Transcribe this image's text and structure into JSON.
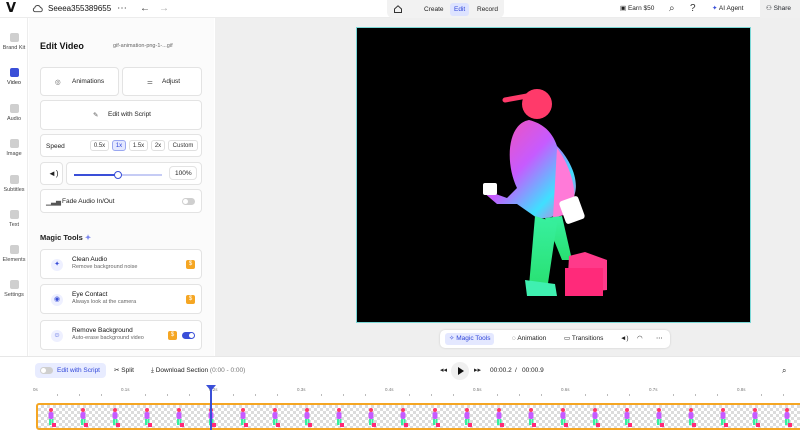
{
  "app": {
    "logo": "V",
    "project_name": "Seeea355389655"
  },
  "header": {
    "more_icon": "ellipsis-icon",
    "modes": [
      "Create",
      "Edit",
      "Record"
    ],
    "active_mode": "Edit",
    "earn": "Earn $50",
    "ai_agent": "AI Agent",
    "share": "Share"
  },
  "nav": [
    {
      "label": "Brand Kit",
      "icon": "brand-kit-icon"
    },
    {
      "label": "Video",
      "icon": "video-icon",
      "active": true
    },
    {
      "label": "Audio",
      "icon": "audio-icon"
    },
    {
      "label": "Image",
      "icon": "image-icon"
    },
    {
      "label": "Subtitles",
      "icon": "subtitles-icon"
    },
    {
      "label": "Text",
      "icon": "text-icon"
    },
    {
      "label": "Elements",
      "icon": "elements-icon"
    },
    {
      "label": "Settings",
      "icon": "settings-icon"
    }
  ],
  "panel": {
    "title": "Edit Video",
    "file": "gif-animation-png-1-...gif",
    "animations": "Animations",
    "adjust": "Adjust",
    "edit_with_script": "Edit with Script",
    "speed_label": "Speed",
    "speeds": [
      "0.5x",
      "1x",
      "1.5x",
      "2x",
      "Custom"
    ],
    "active_speed": "1x",
    "volume_value": "100%",
    "volume_level": 0.5,
    "fade_audio": "Fade Audio In/Out",
    "fade_on": false,
    "magic_tools_title": "Magic Tools",
    "tools": [
      {
        "title": "Clean Audio",
        "subtitle": "Remove background noise",
        "badge": "$"
      },
      {
        "title": "Eye Contact",
        "subtitle": "Always look at the camera",
        "badge": "$"
      },
      {
        "title": "Remove Background",
        "subtitle": "Auto-erase background video",
        "badge": "$",
        "toggle_on": true
      }
    ]
  },
  "canvas_tools": {
    "magic_tools": "Magic Tools",
    "animation": "Animation",
    "transitions": "Transitions"
  },
  "timeline": {
    "edit_with_script": "Edit with Script",
    "split": "Split",
    "download_section": "Download Section",
    "download_range": "(0:00 - 0:00)",
    "current_time": "00:00.2",
    "total_time": "00:00.9",
    "ruler": [
      "0s",
      "0.1s",
      "0.2s",
      "0.3s",
      "0.4s",
      "0.5s",
      "0.6s",
      "0.7s",
      "0.8s"
    ]
  },
  "colors": {
    "accent": "#3a4fd8",
    "badge": "#f5a623",
    "video_border": "#7ad7d6"
  }
}
